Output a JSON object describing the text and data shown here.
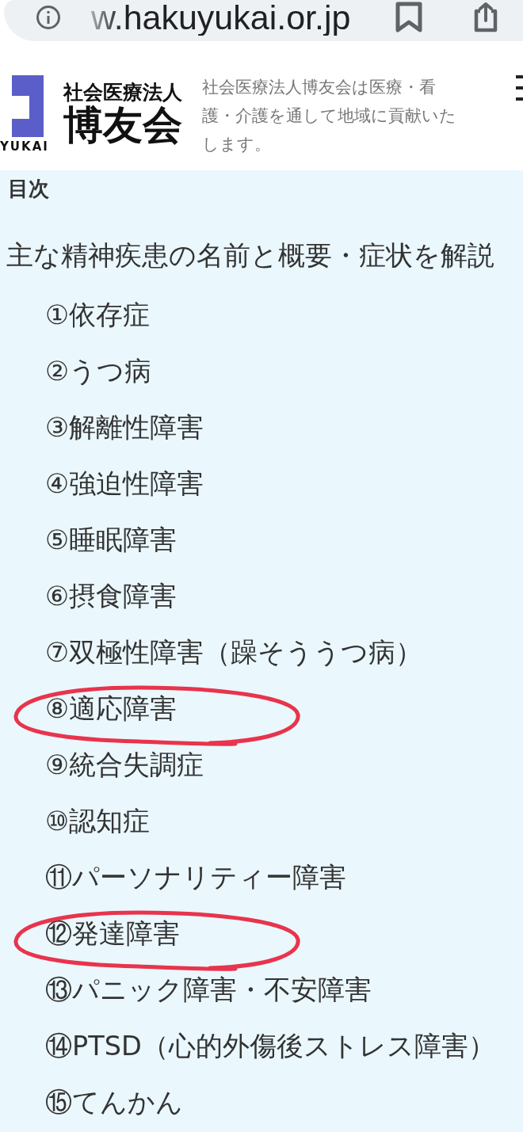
{
  "browser": {
    "url": "w.hakuyukai.or.jp"
  },
  "header": {
    "logo_caption": "YUKAI",
    "logo_subtitle": "社会医療法人",
    "logo_title": "博友会",
    "tagline": "社会医療法人博友会は医療・看護・介護を通して地域に貢献いたします。"
  },
  "toc": {
    "title": "目次",
    "items": [
      {
        "label": "主な精神疾患の名前と概要・症状を解説",
        "circled": false,
        "children": [
          {
            "label": "①依存症",
            "circled": false
          },
          {
            "label": "②うつ病",
            "circled": false
          },
          {
            "label": "③解離性障害",
            "circled": false
          },
          {
            "label": "④強迫性障害",
            "circled": false
          },
          {
            "label": "⑤睡眠障害",
            "circled": false
          },
          {
            "label": "⑥摂食障害",
            "circled": false
          },
          {
            "label": "⑦双極性障害（躁そううつ病）",
            "circled": false
          },
          {
            "label": "⑧適応障害",
            "circled": true
          },
          {
            "label": "⑨統合失調症",
            "circled": false
          },
          {
            "label": "⑩認知症",
            "circled": false
          },
          {
            "label": "⑪パーソナリティー障害",
            "circled": false
          },
          {
            "label": "⑫発達障害",
            "circled": true
          },
          {
            "label": "⑬パニック障害・不安障害",
            "circled": false
          },
          {
            "label": "⑭PTSD（心的外傷後ストレス障害）",
            "circled": false
          },
          {
            "label": "⑮てんかん",
            "circled": false
          }
        ]
      }
    ]
  }
}
